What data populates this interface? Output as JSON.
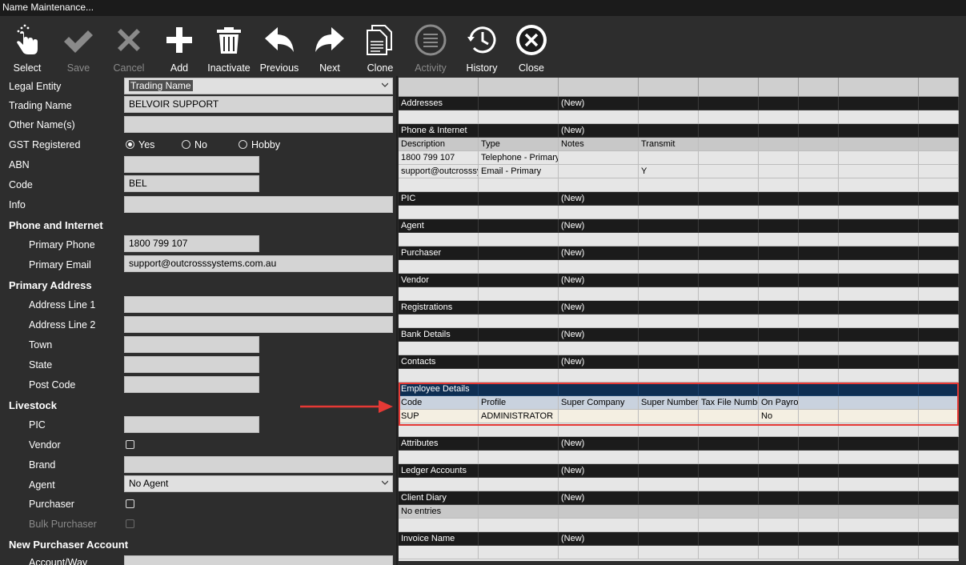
{
  "window": {
    "title": "Name Maintenance..."
  },
  "toolbar": {
    "buttons": [
      {
        "label": "Select",
        "icon": "pointer-hand-icon",
        "enabled": true
      },
      {
        "label": "Save",
        "icon": "checkmark-icon",
        "enabled": false
      },
      {
        "label": "Cancel",
        "icon": "x-cancel-icon",
        "enabled": false
      },
      {
        "label": "Add",
        "icon": "plus-icon",
        "enabled": true
      },
      {
        "label": "Inactivate",
        "icon": "trash-icon",
        "enabled": true
      },
      {
        "label": "Previous",
        "icon": "arrow-left-icon",
        "enabled": true
      },
      {
        "label": "Next",
        "icon": "arrow-right-icon",
        "enabled": true
      },
      {
        "label": "Clone",
        "icon": "documents-icon",
        "enabled": true
      },
      {
        "label": "Activity",
        "icon": "list-icon",
        "enabled": false
      },
      {
        "label": "History",
        "icon": "clock-history-icon",
        "enabled": true
      },
      {
        "label": "Close",
        "icon": "close-circle-icon",
        "enabled": true
      }
    ]
  },
  "form": {
    "legal_entity": {
      "label": "Legal Entity",
      "value": "Trading Name"
    },
    "trading_name": {
      "label": "Trading Name",
      "value": "BELVOIR SUPPORT"
    },
    "other_names": {
      "label": "Other Name(s)",
      "value": ""
    },
    "gst": {
      "label": "GST Registered",
      "options": [
        "Yes",
        "No",
        "Hobby"
      ],
      "selected": "Yes"
    },
    "abn": {
      "label": "ABN",
      "value": ""
    },
    "code": {
      "label": "Code",
      "value": "BEL"
    },
    "info": {
      "label": "Info",
      "value": ""
    },
    "phone_section": "Phone and Internet",
    "primary_phone": {
      "label": "Primary Phone",
      "value": "1800 799 107"
    },
    "primary_email": {
      "label": "Primary Email",
      "value": "support@outcrosssystems.com.au"
    },
    "address_section": "Primary Address",
    "address1": {
      "label": "Address Line 1",
      "value": ""
    },
    "address2": {
      "label": "Address Line 2",
      "value": ""
    },
    "town": {
      "label": "Town",
      "value": ""
    },
    "state": {
      "label": "State",
      "value": ""
    },
    "postcode": {
      "label": "Post Code",
      "value": ""
    },
    "livestock_section": "Livestock",
    "pic": {
      "label": "PIC",
      "value": ""
    },
    "vendor": {
      "label": "Vendor",
      "checked": false
    },
    "brand": {
      "label": "Brand",
      "value": ""
    },
    "agent": {
      "label": "Agent",
      "value": "No Agent"
    },
    "purchaser": {
      "label": "Purchaser",
      "checked": false
    },
    "bulk_purchaser": {
      "label": "Bulk Purchaser",
      "checked": false
    },
    "new_purchaser_section": "New Purchaser Account",
    "account_way": {
      "label": "Account/Way",
      "value": ""
    }
  },
  "grid": {
    "new_label": "(New)",
    "sections": {
      "addresses": "Addresses",
      "phone": "Phone & Internet",
      "pic": "PIC",
      "agent": "Agent",
      "purchaser": "Purchaser",
      "vendor": "Vendor",
      "registrations": "Registrations",
      "bank": "Bank Details",
      "contacts": "Contacts",
      "employee": "Employee Details",
      "attributes": "Attributes",
      "ledger": "Ledger Accounts",
      "diary": "Client Diary",
      "invoice": "Invoice Name"
    },
    "phone_headers": [
      "Description",
      "Type",
      "Notes",
      "Transmit"
    ],
    "phone_rows": [
      [
        "1800 799 107",
        "Telephone - Primary",
        "",
        ""
      ],
      [
        "support@outcrosssystems.com.au",
        "Email - Primary",
        "",
        "Y"
      ]
    ],
    "employee_headers": [
      "Code",
      "Profile",
      "Super Company",
      "Super Number",
      "Tax File Number",
      "On Payroll"
    ],
    "employee_rows": [
      [
        "SUP",
        "ADMINISTRATOR",
        "",
        "",
        "",
        "No"
      ]
    ],
    "diary_empty": "No entries"
  }
}
